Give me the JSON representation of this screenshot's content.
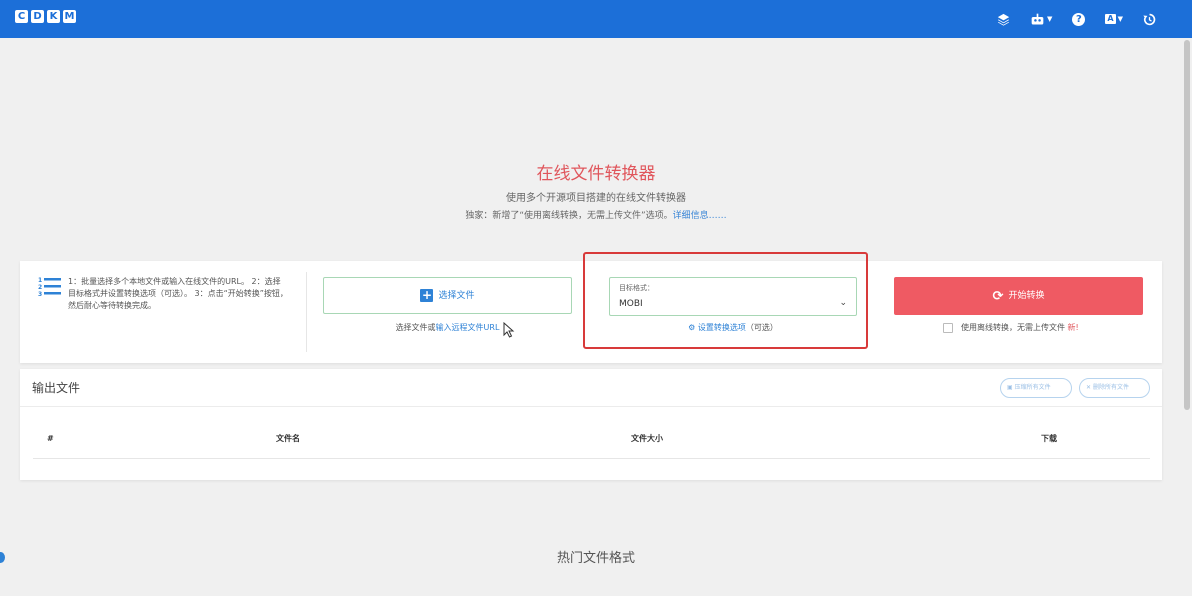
{
  "header": {
    "logo_letters": [
      "C",
      "D",
      "K",
      "M"
    ],
    "icons": [
      "layers-icon",
      "robot-icon",
      "help-icon",
      "language-icon",
      "history-icon"
    ],
    "help_glyph": "?",
    "lang_glyph": "A"
  },
  "hero": {
    "title": "在线文件转换器",
    "subtitle": "使用多个开源项目搭建的在线文件转换器",
    "note_prefix": "独家：新增了“使用离线转换，无需上传文件”选项。",
    "note_link": "详细信息……"
  },
  "convert": {
    "steps_text": "1：批量选择多个本地文件或输入在线文件的URL。 2：选择目标格式并设置转换选项（可选）。 3：点击“开始转换”按钮，然后耐心等待转换完成。",
    "choose_button": "选择文件",
    "choose_hint_prefix": "选择文件或",
    "choose_hint_link": "输入远程文件URL",
    "format_label": "目标格式：",
    "format_value": "MOBI",
    "settings_link": "设置转换选项",
    "settings_optional": "（可选）",
    "start_button": "开始转换",
    "offline_label": "使用离线转换，无需上传文件",
    "offline_new": "新!",
    "offline_checked": false
  },
  "output": {
    "title": "输出文件",
    "zip_button": "压缩所有文件",
    "delete_button": "删除所有文件",
    "columns": [
      "#",
      "文件名",
      "文件大小",
      "下载"
    ]
  },
  "popular": {
    "title": "热门文件格式"
  },
  "colors": {
    "topbar": "#1c6fd8",
    "accent_red": "#ef5a63",
    "link_blue": "#2e82d6",
    "highlight_box": "#d83a3a"
  }
}
